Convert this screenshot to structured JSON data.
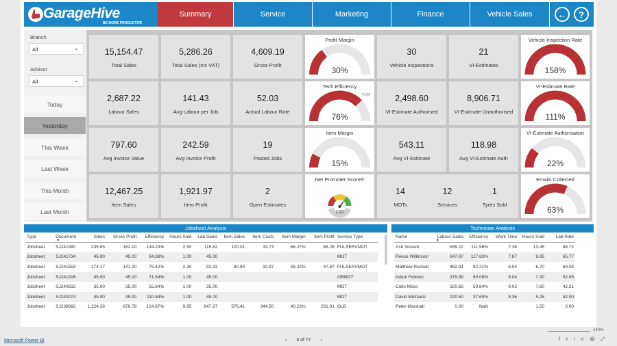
{
  "brand": {
    "name": "GarageHive",
    "tagline": "BE MORE PRODUCTIVE"
  },
  "nav": {
    "tabs": [
      "Summary",
      "Service",
      "Marketing",
      "Finance",
      "Vehicle Sales"
    ],
    "active": "Summary",
    "icons": [
      "back-arrow-icon",
      "help-icon"
    ]
  },
  "filters": {
    "branch_label": "Branch",
    "branch_value": "All",
    "advisor_label": "Advisor",
    "advisor_value": "All",
    "date_buttons": [
      "Today",
      "Yesterday",
      "This Week",
      "Last Week",
      "This Month",
      "Last Month"
    ],
    "selected_date": "Yesterday"
  },
  "kpis": {
    "total_sales": {
      "value": "15,154.47",
      "label": "Total Sales"
    },
    "total_sales_vat": {
      "value": "5,286.26",
      "label": "Total Sales (Inc VAT)"
    },
    "gross_profit": {
      "value": "4,609.19",
      "label": "Gross Profit"
    },
    "vehicle_inspections": {
      "value": "30",
      "label": "Vehicle Inspections"
    },
    "vi_estimates": {
      "value": "21",
      "label": "VI-Estimates"
    },
    "labour_sales": {
      "value": "2,687.22",
      "label": "Labour Sales"
    },
    "avg_labour_per_job": {
      "value": "141.43",
      "label": "Avg Labour per Job"
    },
    "actual_labour_rate": {
      "value": "52.03",
      "label": "Actual Labour Rate"
    },
    "vi_estimate_authorised": {
      "value": "2,498.60",
      "label": "VI-Estimate Authorised"
    },
    "vi_estimate_unauthorised": {
      "value": "8,906.71",
      "label": "VI-Estimate Unauthorised"
    },
    "avg_invoice_value": {
      "value": "797.60",
      "label": "Avg Invoice Value"
    },
    "avg_invoice_profit": {
      "value": "242.59",
      "label": "Avg Invoice Profit"
    },
    "posted_jobs": {
      "value": "19",
      "label": "Posted Jobs"
    },
    "avg_vi_estimate": {
      "value": "543.11",
      "label": "Avg VI-Estimate"
    },
    "avg_vi_estimate_auth": {
      "value": "118.98",
      "label": "Avg VI-Estimate Auth"
    },
    "item_sales": {
      "value": "12,467.25",
      "label": "Item Sales"
    },
    "item_profit": {
      "value": "1,921.97",
      "label": "Item Profit"
    },
    "open_estimates": {
      "value": "2",
      "label": "Open Estimates"
    },
    "mots": {
      "value": "14",
      "label": "MOTs"
    },
    "services": {
      "value": "12",
      "label": "Services"
    },
    "tyres_sold": {
      "value": "1",
      "label": "Tyres Sold"
    }
  },
  "gauges": {
    "profit_margin": {
      "title": "Profit Margin",
      "value_text": "30%",
      "fill": 0.3
    },
    "tech_efficiency": {
      "title": "Tech Efficiency",
      "value_text": "76%",
      "fill": 0.76,
      "target_text": "70.00"
    },
    "item_margin": {
      "title": "Item Margin",
      "value_text": "15%",
      "fill": 0.15
    },
    "vehicle_inspection_rate": {
      "title": "Vehicle Inspection Rate",
      "value_text": "158%",
      "fill": 1.0
    },
    "vi_estimate_rate": {
      "title": "VI-Estimate Rate",
      "value_text": "111%",
      "fill": 1.0
    },
    "vi_estimate_authorisation": {
      "title": "VI-Estimate Authorisation",
      "value_text": "22%",
      "fill": 0.22
    },
    "emails_collected": {
      "title": "Emails Collected",
      "value_text": "63%",
      "fill": 0.63
    },
    "nps": {
      "title": "Net Promoter Score®",
      "value_text": "100"
    }
  },
  "colors": {
    "accent": "#1d86c6",
    "active_tab": "#c0393c",
    "gauge_fill": "#b83235",
    "gauge_track": "#e6e6e6"
  },
  "jobsheet": {
    "title": "Jobsheet Analysis",
    "columns": [
      "Type",
      "Document",
      "Sales",
      "Gross Profit",
      "Efficiency",
      "Hours Sold",
      "Lab Sales",
      "Item Sales",
      "Item Costs",
      "Item Margin",
      "Item Profit",
      "Service Type"
    ],
    "rows": [
      [
        "Jobsheet",
        "SJ241980",
        "235.85",
        "182.10",
        "134.23%",
        "2.50",
        "115.82",
        "100.01",
        "33.73",
        "66.27%",
        "66.28",
        "FULSERVMOT"
      ],
      [
        "Jobsheet",
        "SJ241734",
        "45.00",
        "45.00",
        "64.38%",
        "1.00",
        "45.00",
        "",
        "",
        "",
        "",
        "MOT"
      ],
      [
        "Jobsheet",
        "SJ241553",
        "174.17",
        "141.20",
        "75.42%",
        "2.30",
        "93.33",
        "80.84",
        "32.97",
        "59.22%",
        "47.87",
        "FULSERVMOT"
      ],
      [
        "Jobsheet",
        "SJ241316",
        "45.00",
        "45.00",
        "71.64%",
        "1.00",
        "45.00",
        "",
        "",
        "",
        "",
        "OBMOT"
      ],
      [
        "Jobsheet",
        "SJ240832",
        "35.00",
        "35.00",
        "55.64%",
        "1.00",
        "35.00",
        "",
        "",
        "",
        "",
        "MOT"
      ],
      [
        "Jobsheet",
        "SJ240074",
        "45.00",
        "45.00",
        "110.84%",
        "1.00",
        "45.00",
        "",
        "",
        "",
        "",
        "MOT"
      ],
      [
        "Jobsheet",
        "SJ239982",
        "1,224.28",
        "879.78",
        "124.87%",
        "9.85",
        "647.87",
        "576.41",
        "344.50",
        "40.23%",
        "231.91",
        "OLB"
      ]
    ]
  },
  "technician": {
    "title": "Technician Analysis",
    "columns": [
      "Name",
      "Labour Sales",
      "Efficiency",
      "Work Time",
      "Hours Sold",
      "Lab Rate"
    ],
    "rows": [
      [
        "Ash Yousefi",
        "655.22",
        "111.96%",
        "7.36",
        "13.45",
        "48.72"
      ],
      [
        "Reece Wilkinson",
        "647.87",
        "117.63%",
        "7.87",
        "9.85",
        "65.77"
      ],
      [
        "Matthew Rushall",
        "462.81",
        "82.21%",
        "8.04",
        "6.70",
        "69.08"
      ],
      [
        "Adam Fellows",
        "379.99",
        "60.06%",
        "9.04",
        "7.30",
        "52.05"
      ],
      [
        "Colin Moss",
        "320.83",
        "50.84%",
        "9.02",
        "7.60",
        "42.21"
      ],
      [
        "David Michaels",
        "220.50",
        "37.69%",
        "8.36",
        "5.25",
        "42.00"
      ],
      [
        "Peter Marshall",
        "0.00",
        "NaN",
        "",
        "1.50",
        "0.00"
      ]
    ]
  },
  "footer": {
    "link": "Microsoft Power BI",
    "page": "3 of 77",
    "zoom": "140%",
    "share_icons": [
      "facebook-icon",
      "twitter-icon",
      "linkedin-icon",
      "email-icon",
      "fullscreen-icon"
    ]
  }
}
